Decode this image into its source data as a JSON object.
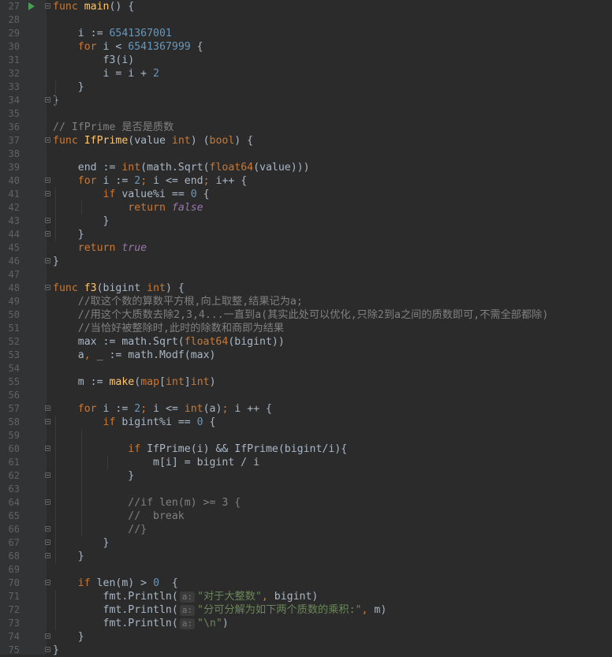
{
  "editor": {
    "lines": [
      {
        "n": "27",
        "run": true,
        "fold": true,
        "toks": [
          [
            "kw",
            "func"
          ],
          [
            "p",
            " "
          ],
          [
            "fn",
            "main"
          ],
          [
            "p",
            "() {"
          ]
        ]
      },
      {
        "n": "28",
        "toks": []
      },
      {
        "n": "29",
        "toks": [
          [
            "p",
            "    i := "
          ],
          [
            "num",
            "6541367001"
          ]
        ]
      },
      {
        "n": "30",
        "toks": [
          [
            "p",
            "    "
          ],
          [
            "kw",
            "for"
          ],
          [
            "p",
            " i < "
          ],
          [
            "num",
            "6541367999"
          ],
          [
            "p",
            " {"
          ]
        ]
      },
      {
        "n": "31",
        "toks": [
          [
            "p",
            "        f3(i)"
          ]
        ]
      },
      {
        "n": "32",
        "toks": [
          [
            "p",
            "        i = i + "
          ],
          [
            "num",
            "2"
          ]
        ]
      },
      {
        "n": "33",
        "toks": [
          [
            "p",
            "    }"
          ]
        ]
      },
      {
        "n": "34",
        "fold": true,
        "toks": [
          [
            "p",
            "}"
          ]
        ]
      },
      {
        "n": "35",
        "toks": []
      },
      {
        "n": "36",
        "toks": [
          [
            "cm",
            "// IfPrime 是否是质数"
          ]
        ]
      },
      {
        "n": "37",
        "fold": true,
        "toks": [
          [
            "kw",
            "func"
          ],
          [
            "p",
            " "
          ],
          [
            "fn",
            "IfPrime"
          ],
          [
            "p",
            "(value "
          ],
          [
            "kw",
            "int"
          ],
          [
            "p",
            ") ("
          ],
          [
            "kw",
            "bool"
          ],
          [
            "p",
            ") {"
          ]
        ]
      },
      {
        "n": "38",
        "toks": []
      },
      {
        "n": "39",
        "toks": [
          [
            "p",
            "    end := "
          ],
          [
            "kw",
            "int"
          ],
          [
            "p",
            "(math.Sqrt("
          ],
          [
            "kw",
            "float64"
          ],
          [
            "p",
            "(value)))"
          ]
        ]
      },
      {
        "n": "40",
        "fold": true,
        "toks": [
          [
            "p",
            "    "
          ],
          [
            "kw",
            "for"
          ],
          [
            "p",
            " i := "
          ],
          [
            "num",
            "2"
          ],
          [
            "kw",
            ";"
          ],
          [
            "p",
            " i <= end"
          ],
          [
            "kw",
            ";"
          ],
          [
            "p",
            " i++ {"
          ]
        ]
      },
      {
        "n": "41",
        "fold": true,
        "toks": [
          [
            "p",
            "        "
          ],
          [
            "kw",
            "if"
          ],
          [
            "p",
            " value%i == "
          ],
          [
            "num",
            "0"
          ],
          [
            "p",
            " {"
          ]
        ]
      },
      {
        "n": "42",
        "toks": [
          [
            "p",
            "            "
          ],
          [
            "kw",
            "return"
          ],
          [
            "p",
            " "
          ],
          [
            "pl",
            "false"
          ]
        ]
      },
      {
        "n": "43",
        "fold": true,
        "toks": [
          [
            "p",
            "        }"
          ]
        ]
      },
      {
        "n": "44",
        "fold": true,
        "toks": [
          [
            "p",
            "    }"
          ]
        ]
      },
      {
        "n": "45",
        "toks": [
          [
            "p",
            "    "
          ],
          [
            "kw",
            "return"
          ],
          [
            "p",
            " "
          ],
          [
            "pl",
            "true"
          ]
        ]
      },
      {
        "n": "46",
        "fold": true,
        "toks": [
          [
            "p",
            "}"
          ]
        ]
      },
      {
        "n": "47",
        "toks": []
      },
      {
        "n": "48",
        "fold": true,
        "toks": [
          [
            "kw",
            "func"
          ],
          [
            "p",
            " "
          ],
          [
            "fn",
            "f3"
          ],
          [
            "p",
            "(bigint "
          ],
          [
            "kw",
            "int"
          ],
          [
            "p",
            ") {"
          ]
        ]
      },
      {
        "n": "49",
        "toks": [
          [
            "cm",
            "    //取这个数的算数平方根,向上取整,结果记为a;"
          ]
        ]
      },
      {
        "n": "50",
        "toks": [
          [
            "cm",
            "    //用这个大质数去除2,3,4...一直到a(其实此处可以优化,只除2到a之间的质数即可,不需全部都除)"
          ]
        ]
      },
      {
        "n": "51",
        "toks": [
          [
            "cm",
            "    //当恰好被整除时,此时的除数和商即为结果"
          ]
        ]
      },
      {
        "n": "52",
        "toks": [
          [
            "p",
            "    max := math.Sqrt("
          ],
          [
            "kw",
            "float64"
          ],
          [
            "p",
            "(bigint))"
          ]
        ]
      },
      {
        "n": "53",
        "toks": [
          [
            "p",
            "    a"
          ],
          [
            "kw",
            ","
          ],
          [
            "p",
            " _ := math.Modf(max)"
          ]
        ]
      },
      {
        "n": "54",
        "toks": []
      },
      {
        "n": "55",
        "toks": [
          [
            "p",
            "    m := "
          ],
          [
            "fn",
            "make"
          ],
          [
            "p",
            "("
          ],
          [
            "kw",
            "map"
          ],
          [
            "p",
            "["
          ],
          [
            "kw",
            "int"
          ],
          [
            "p",
            "]"
          ],
          [
            "kw",
            "int"
          ],
          [
            "p",
            ")"
          ]
        ]
      },
      {
        "n": "56",
        "toks": []
      },
      {
        "n": "57",
        "fold": true,
        "toks": [
          [
            "p",
            "    "
          ],
          [
            "kw",
            "for"
          ],
          [
            "p",
            " i := "
          ],
          [
            "num",
            "2"
          ],
          [
            "kw",
            ";"
          ],
          [
            "p",
            " i <= "
          ],
          [
            "kw",
            "int"
          ],
          [
            "p",
            "(a)"
          ],
          [
            "kw",
            ";"
          ],
          [
            "p",
            " i ++ {"
          ]
        ]
      },
      {
        "n": "58",
        "fold": true,
        "toks": [
          [
            "p",
            "        "
          ],
          [
            "kw",
            "if"
          ],
          [
            "p",
            " bigint%i == "
          ],
          [
            "num",
            "0"
          ],
          [
            "p",
            " {"
          ]
        ]
      },
      {
        "n": "59",
        "toks": []
      },
      {
        "n": "60",
        "fold": true,
        "toks": [
          [
            "p",
            "            "
          ],
          [
            "kw",
            "if"
          ],
          [
            "p",
            " IfPrime(i) && IfPrime(bigint/i){"
          ]
        ]
      },
      {
        "n": "61",
        "toks": [
          [
            "p",
            "                m[i] = bigint / i"
          ]
        ]
      },
      {
        "n": "62",
        "fold": true,
        "toks": [
          [
            "p",
            "            }"
          ]
        ]
      },
      {
        "n": "63",
        "toks": []
      },
      {
        "n": "64",
        "fold": true,
        "toks": [
          [
            "cm",
            "            //if len(m) >= 3 {"
          ]
        ]
      },
      {
        "n": "65",
        "toks": [
          [
            "cm",
            "            //  break"
          ]
        ]
      },
      {
        "n": "66",
        "fold": true,
        "toks": [
          [
            "cm",
            "            //}"
          ]
        ]
      },
      {
        "n": "67",
        "fold": true,
        "toks": [
          [
            "p",
            "        }"
          ]
        ]
      },
      {
        "n": "68",
        "fold": true,
        "toks": [
          [
            "p",
            "    }"
          ]
        ]
      },
      {
        "n": "69",
        "toks": []
      },
      {
        "n": "70",
        "fold": true,
        "toks": [
          [
            "p",
            "    "
          ],
          [
            "kw",
            "if"
          ],
          [
            "p",
            " len(m) > "
          ],
          [
            "num",
            "0"
          ],
          [
            "p",
            "  {"
          ]
        ]
      },
      {
        "n": "71",
        "toks": [
          [
            "p",
            "        fmt.Println("
          ],
          [
            "hint",
            "a:"
          ],
          [
            "str",
            "\"对于大整数\""
          ],
          [
            "kw",
            ","
          ],
          [
            "p",
            " bigint)"
          ]
        ]
      },
      {
        "n": "72",
        "toks": [
          [
            "p",
            "        fmt.Println("
          ],
          [
            "hint",
            "a:"
          ],
          [
            "str",
            "\"分可分解为如下两个质数的乘积:\""
          ],
          [
            "kw",
            ","
          ],
          [
            "p",
            " m)"
          ]
        ]
      },
      {
        "n": "73",
        "toks": [
          [
            "p",
            "        fmt.Println("
          ],
          [
            "hint",
            "a:"
          ],
          [
            "str",
            "\"\\n\""
          ],
          [
            "p",
            ")"
          ]
        ]
      },
      {
        "n": "74",
        "fold": true,
        "toks": [
          [
            "p",
            "    }"
          ]
        ]
      },
      {
        "n": "75",
        "fold": true,
        "toks": [
          [
            "p",
            "}"
          ]
        ]
      }
    ]
  }
}
